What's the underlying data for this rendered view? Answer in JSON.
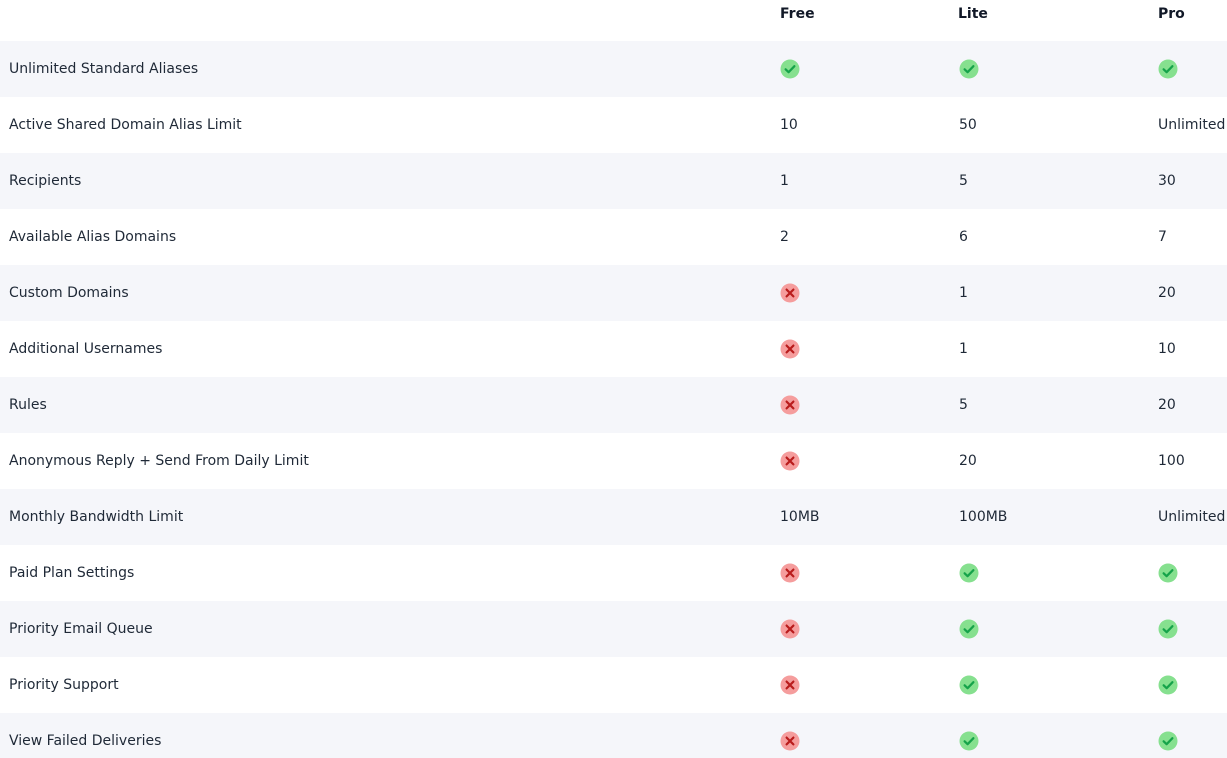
{
  "colors": {
    "check_bg": "#86e08f",
    "check_mark": "#16a34a",
    "cross_bg": "#f59d9d",
    "cross_mark": "#b91c1c",
    "row_alt_bg": "#f5f6fa",
    "text": "#1f2937"
  },
  "header": {
    "free": "Free",
    "lite": "Lite",
    "pro": "Pro"
  },
  "rows": [
    {
      "feature": "Unlimited Standard Aliases",
      "free": "check",
      "lite": "check",
      "pro": "check"
    },
    {
      "feature": "Active Shared Domain Alias Limit",
      "free": "10",
      "lite": "50",
      "pro": "Unlimited"
    },
    {
      "feature": "Recipients",
      "free": "1",
      "lite": "5",
      "pro": "30"
    },
    {
      "feature": "Available Alias Domains",
      "free": "2",
      "lite": "6",
      "pro": "7"
    },
    {
      "feature": "Custom Domains",
      "free": "cross",
      "lite": "1",
      "pro": "20"
    },
    {
      "feature": "Additional Usernames",
      "free": "cross",
      "lite": "1",
      "pro": "10"
    },
    {
      "feature": "Rules",
      "free": "cross",
      "lite": "5",
      "pro": "20"
    },
    {
      "feature": "Anonymous Reply + Send From Daily Limit",
      "free": "cross",
      "lite": "20",
      "pro": "100"
    },
    {
      "feature": "Monthly Bandwidth Limit",
      "free": "10MB",
      "lite": "100MB",
      "pro": "Unlimited"
    },
    {
      "feature": "Paid Plan Settings",
      "free": "cross",
      "lite": "check",
      "pro": "check"
    },
    {
      "feature": "Priority Email Queue",
      "free": "cross",
      "lite": "check",
      "pro": "check"
    },
    {
      "feature": "Priority Support",
      "free": "cross",
      "lite": "check",
      "pro": "check"
    },
    {
      "feature": "View Failed Deliveries",
      "free": "cross",
      "lite": "check",
      "pro": "check"
    }
  ]
}
